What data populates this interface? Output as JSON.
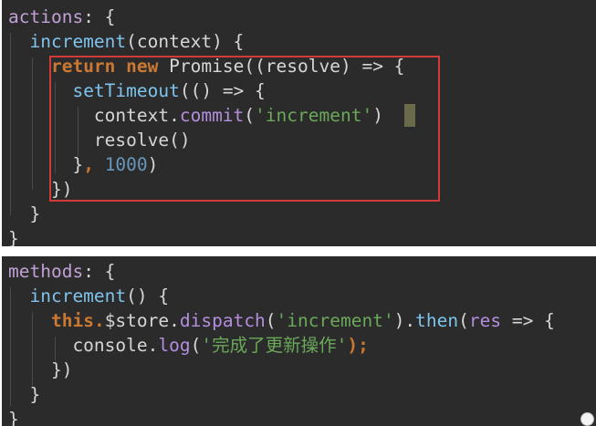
{
  "colors": {
    "editor_bg": "#2b2b2b",
    "plain": "#d6d6d6",
    "object_key": "#c0a0d6",
    "function_name": "#7ec3ec",
    "keyword": "#cb7832",
    "string": "#6aa85a",
    "number": "#6897bb",
    "method": "#b48ede",
    "highlight_border": "#d03a3a"
  },
  "panels": [
    {
      "name": "actions-panel",
      "highlighted_lines": [
        2,
        7
      ],
      "lines": [
        [
          {
            "t": "actions",
            "c": "key"
          },
          {
            "t": ": {",
            "c": "plain"
          }
        ],
        [
          {
            "t": "  ",
            "c": "plain"
          },
          {
            "t": "increment",
            "c": "fn"
          },
          {
            "t": "(context) {",
            "c": "plain"
          }
        ],
        [
          {
            "t": "    ",
            "c": "plain"
          },
          {
            "t": "return",
            "c": "kw"
          },
          {
            "t": " ",
            "c": "plain"
          },
          {
            "t": "new",
            "c": "kw"
          },
          {
            "t": " Promise((resolve) => {",
            "c": "plain"
          }
        ],
        [
          {
            "t": "      ",
            "c": "plain"
          },
          {
            "t": "setTimeout",
            "c": "fn"
          },
          {
            "t": "(() => {",
            "c": "plain"
          }
        ],
        [
          {
            "t": "        context.",
            "c": "plain"
          },
          {
            "t": "commit",
            "c": "prop"
          },
          {
            "t": "(",
            "c": "plain"
          },
          {
            "t": "'increment'",
            "c": "str"
          },
          {
            "t": ")",
            "c": "plain"
          }
        ],
        [
          {
            "t": "        resolve()",
            "c": "plain"
          }
        ],
        [
          {
            "t": "      }",
            "c": "plain"
          },
          {
            "t": ",",
            "c": "kw"
          },
          {
            "t": " ",
            "c": "plain"
          },
          {
            "t": "1000",
            "c": "num"
          },
          {
            "t": ")",
            "c": "plain"
          }
        ],
        [
          {
            "t": "    })",
            "c": "plain"
          }
        ],
        [
          {
            "t": "  }",
            "c": "plain"
          }
        ],
        [
          {
            "t": "}",
            "c": "plain"
          }
        ]
      ]
    },
    {
      "name": "methods-panel",
      "lines": [
        [
          {
            "t": "methods",
            "c": "key"
          },
          {
            "t": ": {",
            "c": "plain"
          }
        ],
        [
          {
            "t": "  ",
            "c": "plain"
          },
          {
            "t": "increment",
            "c": "fn"
          },
          {
            "t": "() {",
            "c": "plain"
          }
        ],
        [
          {
            "t": "    ",
            "c": "plain"
          },
          {
            "t": "this",
            "c": "kw"
          },
          {
            "t": ".",
            "c": "kw"
          },
          {
            "t": "$store.",
            "c": "plain"
          },
          {
            "t": "dispatch",
            "c": "prop"
          },
          {
            "t": "(",
            "c": "plain"
          },
          {
            "t": "'increment'",
            "c": "str"
          },
          {
            "t": ").",
            "c": "plain"
          },
          {
            "t": "then",
            "c": "fn"
          },
          {
            "t": "(",
            "c": "plain"
          },
          {
            "t": "res",
            "c": "prop"
          },
          {
            "t": " => {",
            "c": "plain"
          }
        ],
        [
          {
            "t": "      console.",
            "c": "plain"
          },
          {
            "t": "log",
            "c": "prop"
          },
          {
            "t": "(",
            "c": "plain"
          },
          {
            "t": "'完成了更新操作'",
            "c": "str"
          },
          {
            "t": ");",
            "c": "kw"
          }
        ],
        [
          {
            "t": "    })",
            "c": "plain"
          }
        ],
        [
          {
            "t": "  }",
            "c": "plain"
          }
        ],
        [
          {
            "t": "}",
            "c": "plain"
          }
        ]
      ]
    }
  ]
}
